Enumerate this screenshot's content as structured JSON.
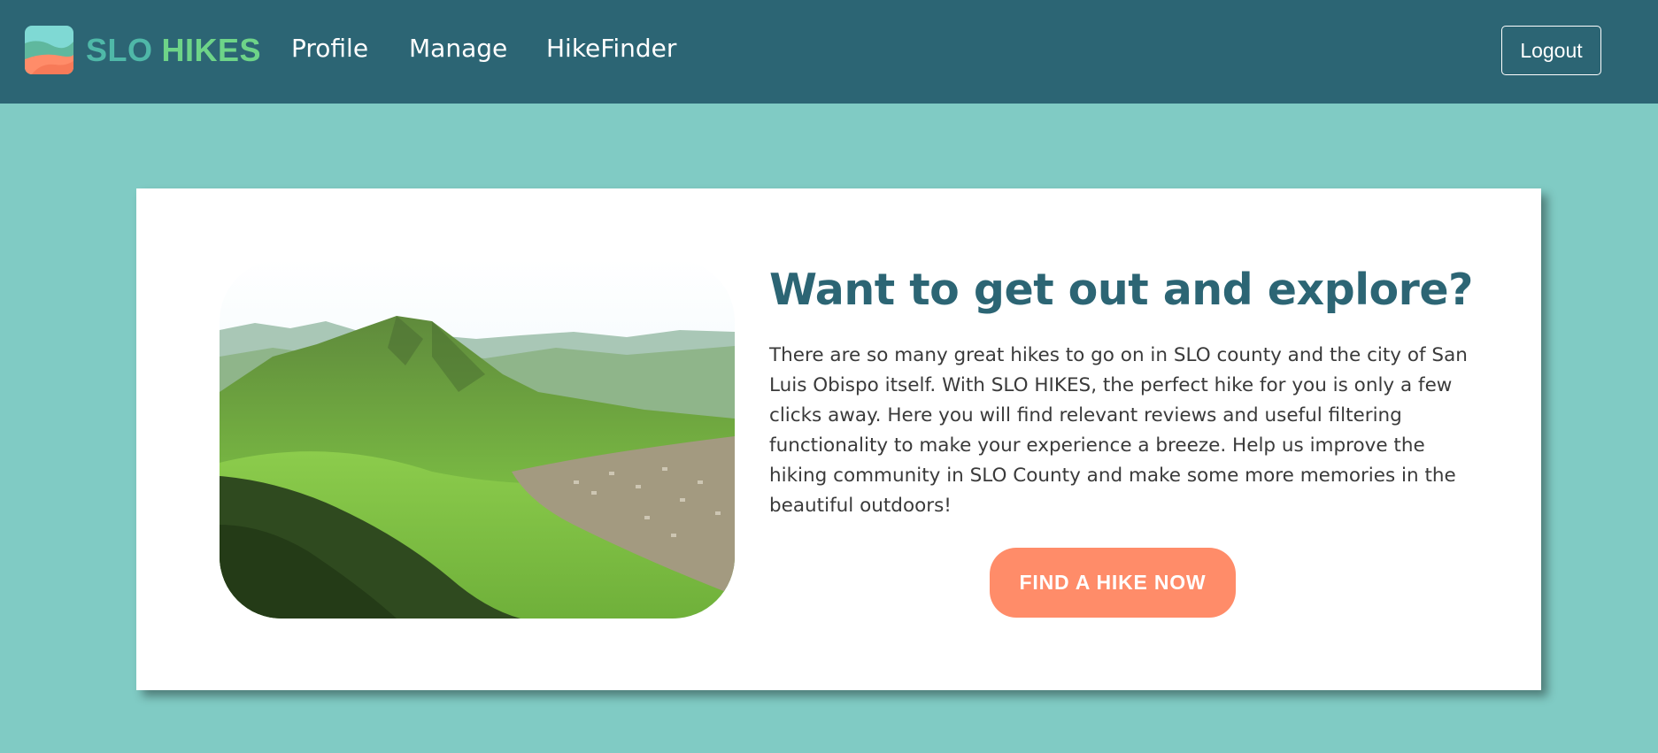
{
  "navbar": {
    "brand": {
      "part1": "SLO",
      "part2": "HIKES",
      "logo_icon": "landscape-logo-icon"
    },
    "links": [
      {
        "label": "Profile"
      },
      {
        "label": "Manage"
      },
      {
        "label": "HikeFinder"
      }
    ],
    "logout_label": "Logout"
  },
  "hero": {
    "image_subject": "mountain-landscape-photo",
    "headline": "Want to get out and explore?",
    "description": "There are so many great hikes to go on in SLO county and the city of San Luis Obispo itself. With SLO HIKES, the perfect hike for you is only a few clicks away. Here you will find relevant reviews and useful filtering functionality to make your experience a breeze. Help us improve the hiking community in SLO County and make some more memories in the beautiful outdoors!",
    "cta_label": "FIND A HIKE NOW"
  },
  "colors": {
    "page_bg": "#80cbc4",
    "navbar_bg": "#2c6574",
    "headline": "#2c6574",
    "cta_bg": "#ff8c69",
    "brand_slo": "#4fb8a8",
    "brand_hikes": "#6ed488"
  }
}
